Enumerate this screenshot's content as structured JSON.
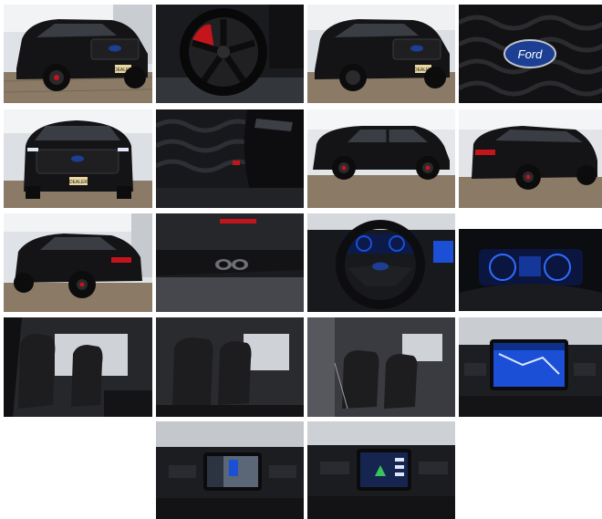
{
  "gallery": {
    "photos": [
      {
        "subject": "front three-quarter exterior",
        "plate": "DEALER"
      },
      {
        "subject": "wheel and red brake caliper"
      },
      {
        "subject": "front three-quarter exterior angle",
        "plate": "DEALER"
      },
      {
        "subject": "front grille badge",
        "badge": "Ford"
      },
      {
        "subject": "front view",
        "plate": "DEALER"
      },
      {
        "subject": "headlight and grille detail"
      },
      {
        "subject": "side profile"
      },
      {
        "subject": "rear three-quarter exterior"
      },
      {
        "subject": "rear three-quarter exterior angle"
      },
      {
        "subject": "rear bumper and exhausts"
      },
      {
        "subject": "steering wheel and cluster"
      },
      {
        "subject": "digital instrument cluster"
      },
      {
        "subject": "front seats"
      },
      {
        "subject": "second row seats"
      },
      {
        "subject": "third row seats"
      },
      {
        "subject": "center touchscreen navigation"
      },
      {
        "subject": "center touchscreen camera"
      },
      {
        "subject": "center touchscreen drive mode"
      }
    ]
  },
  "colors": {
    "vehicle_black": "#141416",
    "floor_wood": "#8a7a66",
    "wall_white": "#e9ebee",
    "caliper_red": "#c4141c",
    "ford_blue": "#1c3f94",
    "screen_blue": "#1b4fd6",
    "leather_black": "#1d1d1f"
  }
}
